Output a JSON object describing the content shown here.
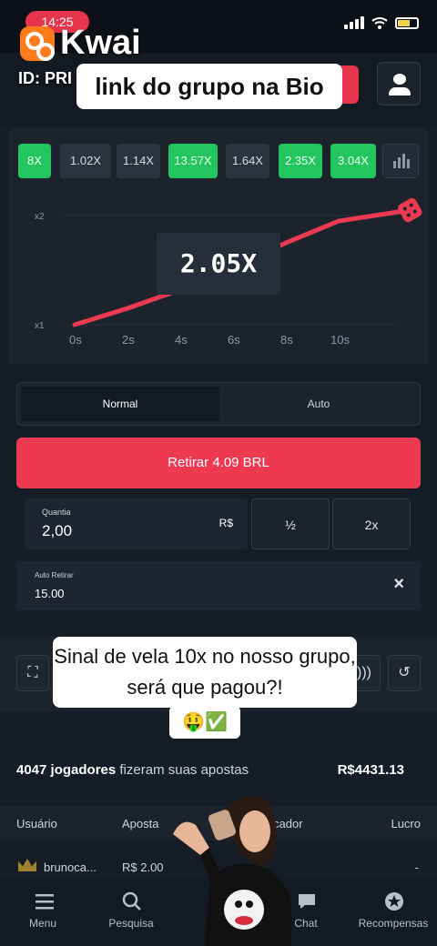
{
  "status_bar": {
    "time": "14:25"
  },
  "overlay": {
    "brand": "Kwai",
    "id_text": "ID: PRI",
    "link_banner": "link do grupo na Bio",
    "caption": "Sinal de vela 10x no nosso grupo, será que pagou?!",
    "emoji": "🤑✅"
  },
  "history": [
    "8X",
    "1.02X",
    "1.14X",
    "13.57X",
    "1.64X",
    "2.35X",
    "3.04X"
  ],
  "history_highlighted": [
    0,
    3,
    5,
    6
  ],
  "chart_data": {
    "type": "line",
    "current_multiplier": "2.05X",
    "y_ticks": [
      "x2",
      "x1"
    ],
    "x_ticks": [
      "0s",
      "2s",
      "4s",
      "6s",
      "8s",
      "10s"
    ],
    "line_color": "#ed3a51",
    "points": [
      [
        0,
        1.0
      ],
      [
        2,
        1.15
      ],
      [
        4,
        1.32
      ],
      [
        6,
        1.52
      ],
      [
        8,
        1.75
      ],
      [
        10,
        1.95
      ],
      [
        12.7,
        2.05
      ]
    ]
  },
  "mode_tabs": {
    "normal": "Normal",
    "auto": "Auto"
  },
  "withdraw_button": "Retirar 4.09 BRL",
  "bet": {
    "amount_label": "Quantia",
    "amount_value": "2,00",
    "currency": "R$",
    "half_label": "½",
    "double_label": "2x"
  },
  "auto_withdraw": {
    "label": "Auto Retirar",
    "value": "15.00",
    "close": "×"
  },
  "players": {
    "count_text": "4047 jogadores",
    "suffix": "fizeram suas apostas",
    "total": "R$4431.13"
  },
  "table": {
    "headers": {
      "user": "Usuário",
      "bet": "Aposta",
      "multiplier": "cador",
      "profit": "Lucro"
    },
    "rows": [
      {
        "user": "brunoca...",
        "bet": "R$ 2.00",
        "profit": "-"
      }
    ]
  },
  "nav": [
    {
      "label": "Menu"
    },
    {
      "label": "Pesquisa"
    },
    {
      "label": ""
    },
    {
      "label": "Chat"
    },
    {
      "label": "Recompensas"
    }
  ]
}
